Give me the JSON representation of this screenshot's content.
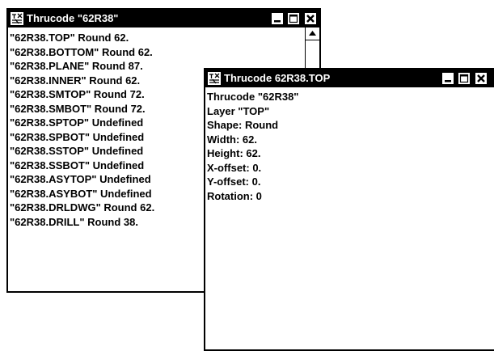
{
  "window1": {
    "title": "Thrucode \"62R38\"",
    "lines": [
      "\"62R38.TOP\"  Round 62.",
      "\"62R38.BOTTOM\"  Round 62.",
      "\"62R38.PLANE\"  Round 87.",
      "\"62R38.INNER\"  Round 62.",
      "\"62R38.SMTOP\"  Round 72.",
      "\"62R38.SMBOT\"  Round 72.",
      "\"62R38.SPTOP\"  Undefined",
      "\"62R38.SPBOT\"  Undefined",
      "\"62R38.SSTOP\"  Undefined",
      "\"62R38.SSBOT\"  Undefined",
      "\"62R38.ASYTOP\"  Undefined",
      "\"62R38.ASYBOT\"  Undefined",
      "\"62R38.DRLDWG\"  Round 62.",
      "\"62R38.DRILL\"  Round 38."
    ]
  },
  "window2": {
    "title": "Thrucode 62R38.TOP",
    "lines": [
      "Thrucode \"62R38\"",
      "Layer \"TOP\"",
      "Shape:  Round",
      "Width: 62.",
      "Height: 62.",
      "X-offset: 0.",
      "Y-offset: 0.",
      "Rotation: 0"
    ]
  },
  "icons": {
    "system": "thrucode-app-icon",
    "minimize": "minimize-icon",
    "maximize": "maximize-icon",
    "close": "close-icon",
    "scroll_up": "scroll-up-arrow-icon"
  },
  "colors": {
    "titlebar": "#000000",
    "background": "#ffffff",
    "text": "#000000"
  }
}
